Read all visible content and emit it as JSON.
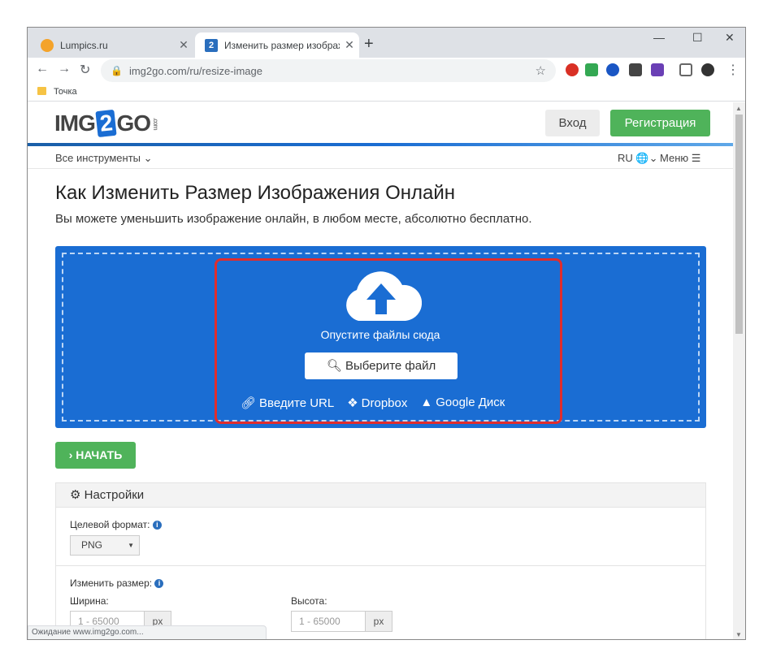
{
  "tabs": [
    {
      "title": "Lumpics.ru",
      "close": "✕"
    },
    {
      "title": "Изменить размер изображений",
      "close": "✕",
      "favicon_text": "2"
    }
  ],
  "new_tab": "+",
  "window_controls": {
    "minimize": "—",
    "maximize": "☐",
    "close": "✕"
  },
  "address_bar": {
    "url": "img2go.com/ru/resize-image"
  },
  "bookmarks": [
    {
      "label": "Точка"
    }
  ],
  "site": {
    "logo": {
      "left": "IMG",
      "num": "2",
      "right": "GO",
      "suffix": ".com"
    },
    "login": "Вход",
    "register": "Регистрация",
    "all_tools": "Все инструменты",
    "lang": "RU",
    "menu": "Меню",
    "title": "Как Изменить Размер Изображения Онлайн",
    "subtitle": "Вы можете уменьшить изображение онлайн, в любом месте, абсолютно бесплатно.",
    "upload": {
      "drop_text": "Опустите файлы сюда",
      "choose_file": "Выберите файл",
      "url": "Введите URL",
      "dropbox": "Dropbox",
      "gdrive": "Google Диск"
    },
    "start": "НАЧАТЬ",
    "settings": {
      "header": "Настройки",
      "target_format_label": "Целевой формат:",
      "target_format_value": "PNG",
      "resize_label": "Изменить размер:",
      "width_label": "Ширина:",
      "height_label": "Высота:",
      "width_placeholder": "1 - 65000",
      "height_placeholder": "1 - 65000",
      "unit": "px"
    }
  },
  "status": "Ожидание www.img2go.com...",
  "colors": {
    "accent_blue": "#1a6dd3",
    "green": "#4fb35a",
    "highlight": "#e02d2d"
  }
}
